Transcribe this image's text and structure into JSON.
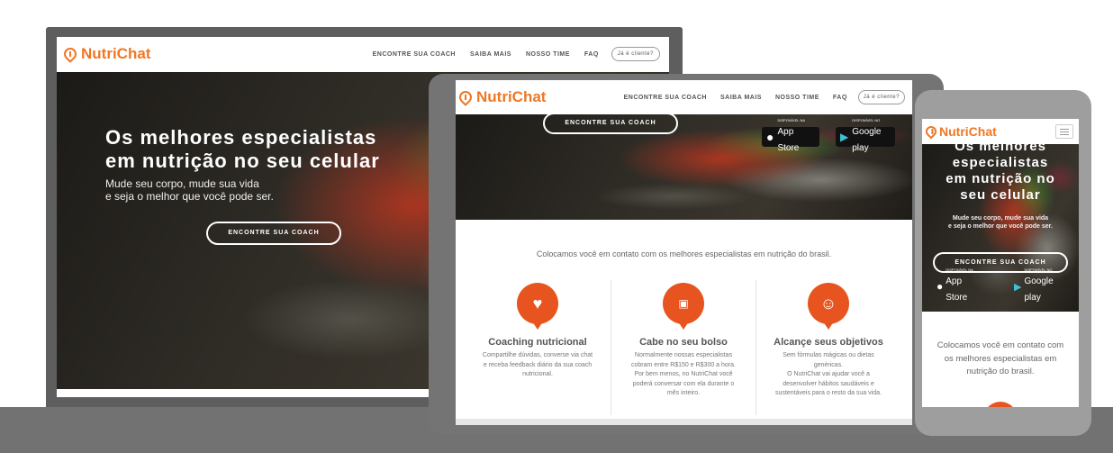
{
  "brand": {
    "name": "NutriChat",
    "accent": "#ef7724",
    "icon_orange": "#e8541f"
  },
  "nav": {
    "items": [
      "ENCONTRE SUA COACH",
      "SAIBA MAIS",
      "NOSSO TIME",
      "FAQ"
    ],
    "client_button": "Já é cliente?",
    "menu_icon": "hamburger-menu-icon"
  },
  "hero": {
    "title_line1": "Os melhores especialistas",
    "title_line2": "em nutrição no seu celular",
    "subtitle_line1": "Mude seu corpo, mude sua vida",
    "subtitle_line2": "e seja o melhor que você pode ser.",
    "cta": "ENCONTRE SUA COACH",
    "phone_title_line1": "Os melhores",
    "phone_title_line2": "especialistas",
    "phone_title_line3": "em nutrição no",
    "phone_title_line4": "seu celular"
  },
  "stores": {
    "app_store_small": "DISPONÍVEL NA",
    "app_store_big": "App Store",
    "google_small": "DISPONÍVEL NO",
    "google_big": "Google play"
  },
  "intro": {
    "text": "Colocamos você em contato com os melhores especialistas em nutrição do brasil.",
    "phone_line1": "Colocamos você em contato com",
    "phone_line2": "os melhores especialistas em",
    "phone_line3": "nutrição do brasil."
  },
  "features": [
    {
      "icon": "heart-icon",
      "title": "Coaching nutricional",
      "lines": [
        "Compartilhe dúvidas, converse via chat",
        "e receba feedback diário da sua coach",
        "nutricional."
      ]
    },
    {
      "icon": "money-icon",
      "title": "Cabe no seu bolso",
      "lines": [
        "Normalmente nossas especialistas",
        "cobram entre R$150 e R$300 a hora.",
        "Por bem menos, no NutriChat você",
        "poderá conversar com ela durante o",
        "mês inteiro."
      ]
    },
    {
      "icon": "smile-icon",
      "title": "Alcançe seus objetivos",
      "lines": [
        "Sem fórmulas mágicas ou dietas",
        "genéricas.",
        "O NutriChat vai ajudar você a",
        "desenvolver hábitos saudáveis e",
        "sustentáveis para o resto da sua vida."
      ]
    }
  ]
}
